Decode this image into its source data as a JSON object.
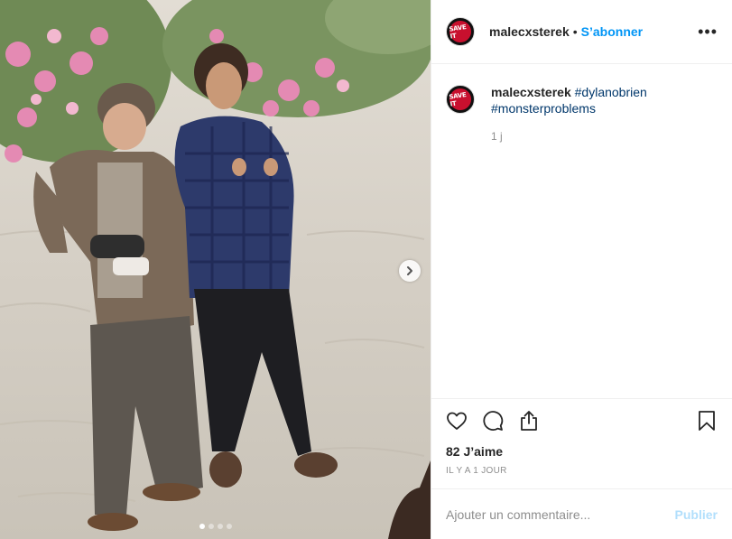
{
  "header": {
    "avatar_text": "SAVE IT",
    "username": "malecxsterek",
    "separator": "•",
    "follow_label": "S’abonner",
    "more_label": "•••"
  },
  "caption": {
    "username": "malecxsterek",
    "tags": [
      "#dylanobrien",
      "#monsterproblems"
    ],
    "time": "1 j"
  },
  "media": {
    "slide_count": 4,
    "active_slide": 1
  },
  "engagement": {
    "likes_text": "82 J’aime",
    "posted_text": "IL Y A 1 JOUR"
  },
  "comment_box": {
    "placeholder": "Ajouter un commentaire...",
    "publish_label": "Publier"
  },
  "colors": {
    "accent": "#0095f6",
    "hashtag": "#00376b",
    "muted": "#8e8e8e",
    "publish_disabled": "#b2dffc",
    "brand_red": "#c8102e"
  },
  "icons": {
    "like": "heart-icon",
    "comment": "comment-icon",
    "share": "share-icon",
    "save": "bookmark-icon",
    "next": "chevron-right-icon"
  }
}
